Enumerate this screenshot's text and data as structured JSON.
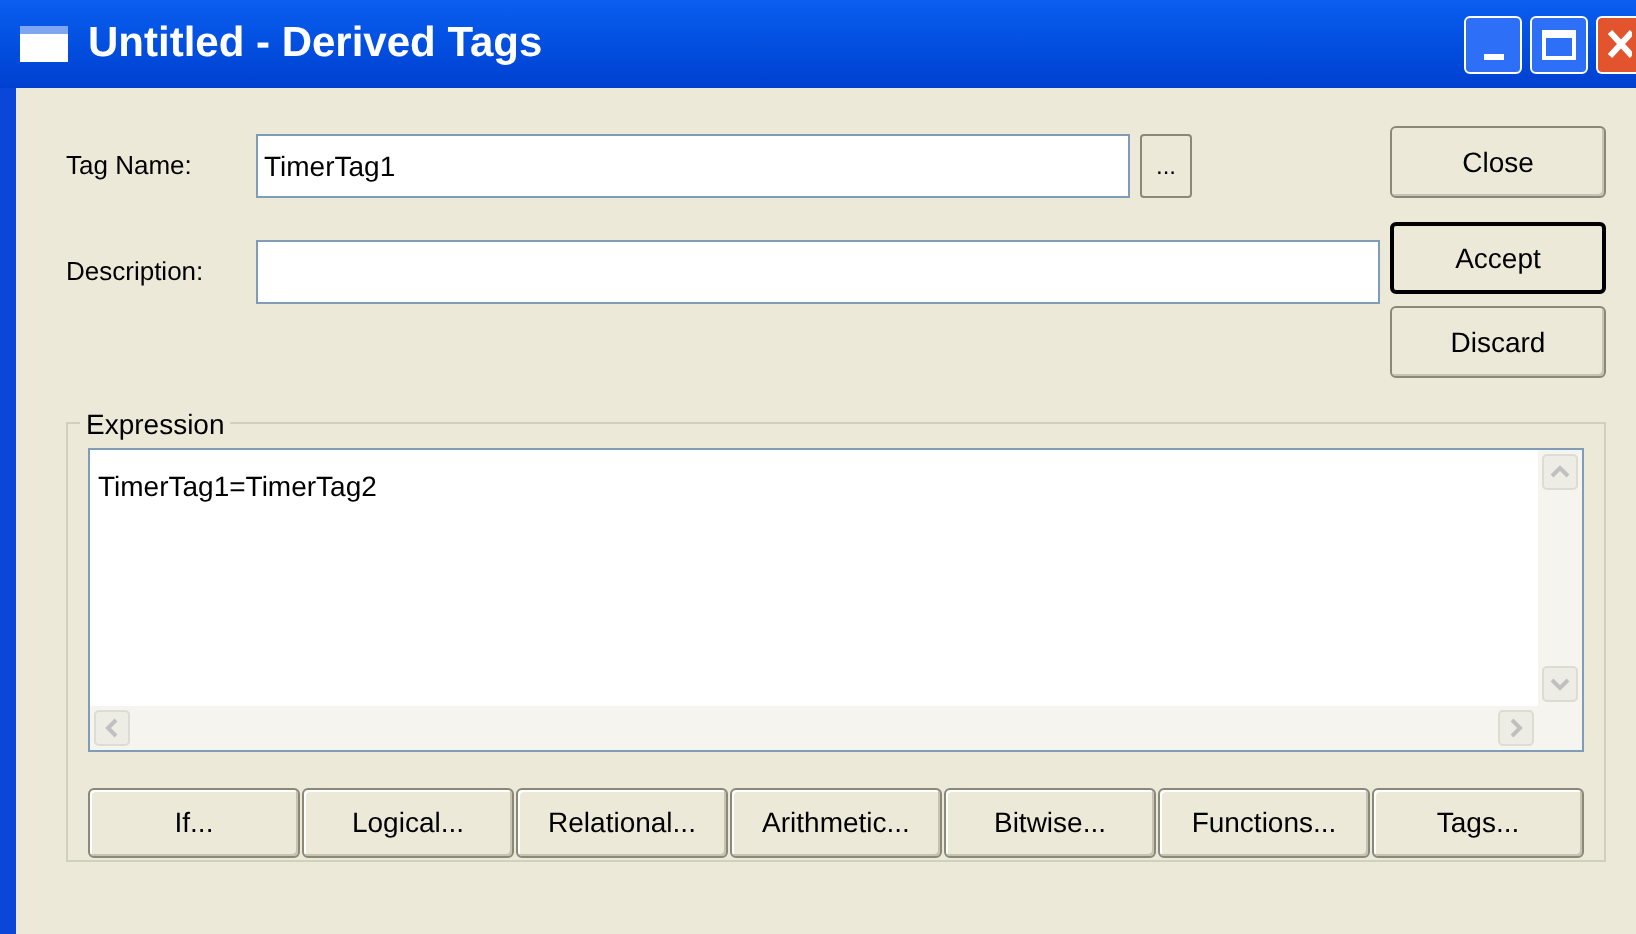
{
  "window": {
    "title": "Untitled - Derived Tags"
  },
  "tag_name": {
    "label": "Tag Name:",
    "value": "TimerTag1",
    "browse": "..."
  },
  "description": {
    "label": "Description:"
  },
  "side_buttons": [
    {
      "label": "Close",
      "default": false
    },
    {
      "label": "Accept",
      "default": true
    },
    {
      "label": "Discard",
      "default": false
    }
  ],
  "expression": {
    "label": "Expression",
    "value": "TimerTag1=TimerTag2"
  },
  "operator_buttons": [
    "If...",
    "Logical...",
    "Relational...",
    "Arithmetic...",
    "Bitwise...",
    "Functions...",
    "Tags..."
  ]
}
